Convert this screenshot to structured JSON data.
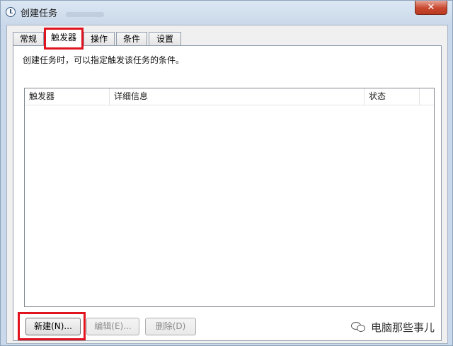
{
  "window": {
    "title": "创建任务",
    "close_label": "✕"
  },
  "tabs": [
    {
      "label": "常规"
    },
    {
      "label": "触发器",
      "active": true
    },
    {
      "label": "操作"
    },
    {
      "label": "条件"
    },
    {
      "label": "设置"
    }
  ],
  "panel": {
    "description": "创建任务时，可以指定触发该任务的条件。"
  },
  "list": {
    "columns": [
      "触发器",
      "详细信息",
      "状态"
    ],
    "rows": []
  },
  "buttons": {
    "new": "新建(N)...",
    "edit": "编辑(E)...",
    "delete": "删除(D)"
  },
  "watermark": {
    "text": "电脑那些事儿"
  },
  "colors": {
    "highlight": "#e0141f",
    "close_button": "#c8472f"
  }
}
